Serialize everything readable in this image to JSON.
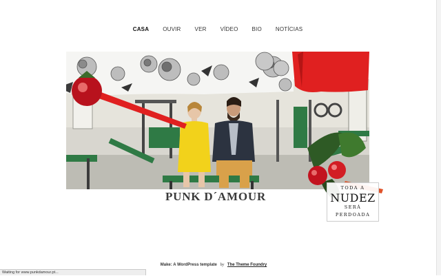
{
  "nav": {
    "items": [
      {
        "label": "CASA",
        "active": true
      },
      {
        "label": "OUVIR",
        "active": false
      },
      {
        "label": "VER",
        "active": false
      },
      {
        "label": "VÍDEO",
        "active": false
      },
      {
        "label": "BIO",
        "active": false
      },
      {
        "label": "NOTÍCIAS",
        "active": false
      }
    ]
  },
  "hero": {
    "quote_line1": "TODA A",
    "quote_line2": "NUDEZ",
    "quote_line3": "SERÁ PERDOADA"
  },
  "site_title": "PUNK D´AMOUR",
  "footer": {
    "credit": "Make: A WordPress template",
    "by": "by",
    "link": "The Theme Foundry"
  },
  "status": {
    "text": "Waiting for www.punkdamour.pt..."
  },
  "colors": {
    "accent_red": "#e02020",
    "gym_green": "#2f7a45",
    "dress_yellow": "#f2d21b"
  }
}
